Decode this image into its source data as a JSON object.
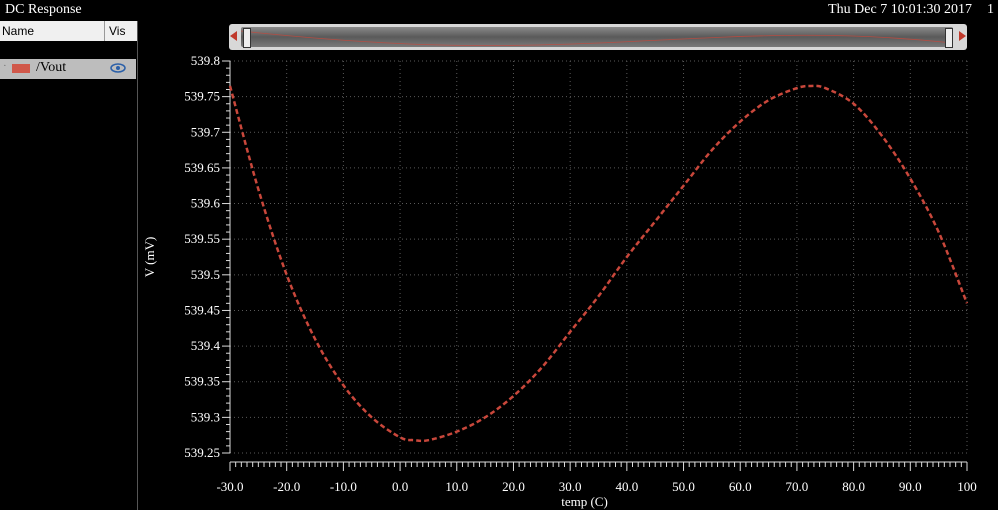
{
  "window": {
    "title": "DC Response",
    "datetime": "Thu Dec 7 10:01:30 2017",
    "subwindow_number": "1"
  },
  "side_panel": {
    "col_name": "Name",
    "col_vis": "Vis",
    "signals": [
      {
        "label": "/Vout",
        "color": "#d0584a",
        "visible_icon": "eye-icon"
      }
    ]
  },
  "colors": {
    "trace": "#c9473b",
    "grid": "#5a5a5a",
    "background": "#000000"
  },
  "chart_data": {
    "type": "line",
    "xlabel": "temp (C)",
    "ylabel": "V (mV)",
    "xlim": [
      -30,
      100
    ],
    "ylim": [
      539.25,
      539.8
    ],
    "grid": true,
    "line_style": "dashed",
    "x_ticks": [
      -30,
      -20,
      -10,
      0,
      10,
      20,
      30,
      40,
      50,
      60,
      70,
      80,
      90,
      100
    ],
    "x_tick_labels": [
      "-30.0",
      "-20.0",
      "-10.0",
      "0.0",
      "10.0",
      "20.0",
      "30.0",
      "40.0",
      "50.0",
      "60.0",
      "70.0",
      "80.0",
      "90.0",
      "100"
    ],
    "y_ticks": [
      539.25,
      539.3,
      539.35,
      539.4,
      539.45,
      539.5,
      539.55,
      539.6,
      539.65,
      539.7,
      539.75,
      539.8
    ],
    "y_tick_labels": [
      "539.25",
      "539.3",
      "539.35",
      "539.4",
      "539.45",
      "539.5",
      "539.55",
      "539.6",
      "539.65",
      "539.7",
      "539.75",
      "539.8"
    ],
    "series": [
      {
        "name": "/Vout",
        "x": [
          -30,
          -25,
          -20,
          -15,
          -10,
          -5,
          0,
          2.5,
          5,
          10,
          15,
          20,
          25,
          30,
          35,
          40,
          45,
          50,
          55,
          60,
          65,
          70,
          72.5,
          75,
          80,
          85,
          90,
          95,
          100
        ],
        "y": [
          539.765,
          539.62,
          539.5,
          539.41,
          539.345,
          539.3,
          539.272,
          539.268,
          539.268,
          539.28,
          539.3,
          539.33,
          539.37,
          539.42,
          539.47,
          539.525,
          539.575,
          539.625,
          539.675,
          539.715,
          539.745,
          539.762,
          539.765,
          539.762,
          539.74,
          539.695,
          539.635,
          539.56,
          539.46
        ]
      }
    ]
  }
}
